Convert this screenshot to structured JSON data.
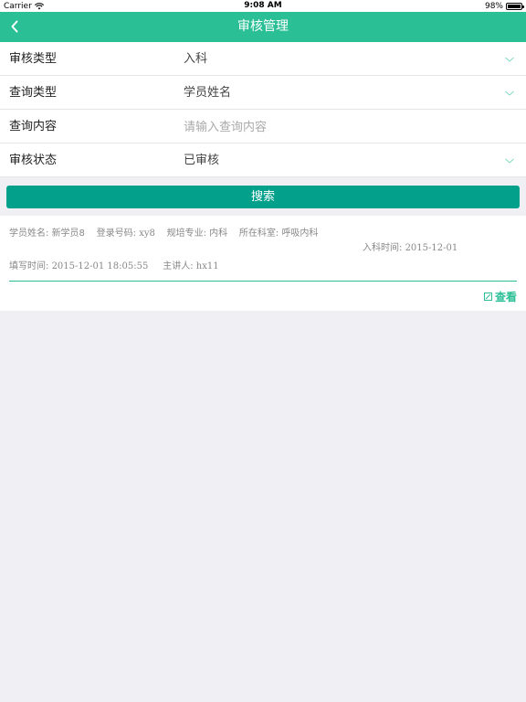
{
  "status_bar": {
    "carrier": "Carrier",
    "time": "9:08 AM",
    "battery": "98%",
    "battery_level": 0.98
  },
  "nav": {
    "title": "审核管理",
    "color": "#2bbf96"
  },
  "form": {
    "rows": [
      {
        "label": "审核类型",
        "value": "入科"
      },
      {
        "label": "查询类型",
        "value": "学员姓名"
      },
      {
        "label": "查询内容",
        "placeholder": "请输入查询内容",
        "value": ""
      },
      {
        "label": "审核状态",
        "value": "已审核"
      }
    ]
  },
  "search": {
    "label": "搜索",
    "color": "#03a08c"
  },
  "record": {
    "name_label": "学员姓名:",
    "name": "新学员8",
    "login_label": "登录号码:",
    "login": "xy8",
    "major_label": "规培专业:",
    "major": "内科",
    "dept_label": "所在科室:",
    "dept": "呼吸内科",
    "entry_label": "入科时间:",
    "entry": "2015-12-01",
    "filled_label": "填写时间:",
    "filled": "2015-12-01 18:05:55",
    "speaker_label": "主讲人:",
    "speaker": "hx11",
    "view_label": "查看"
  }
}
